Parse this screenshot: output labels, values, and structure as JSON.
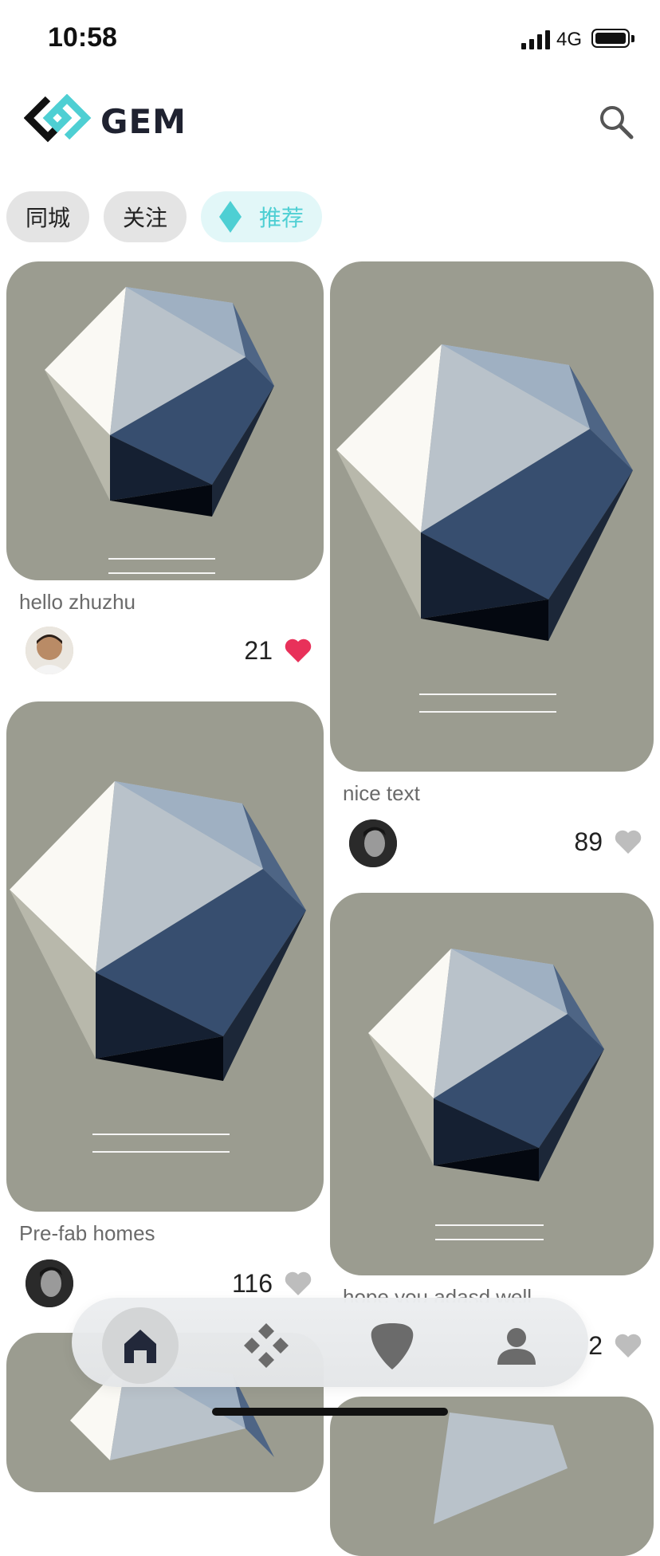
{
  "status_bar": {
    "time": "10:58",
    "network": "4G"
  },
  "header": {
    "logo_text": "GEM",
    "search_icon": "search-icon"
  },
  "tabs": [
    {
      "label": "同城",
      "active": false
    },
    {
      "label": "关注",
      "active": false
    },
    {
      "label": "推荐",
      "active": true,
      "icon": "diamond-icon"
    }
  ],
  "colors": {
    "accent": "#4ecfd3",
    "card_bg": "#9b9c90",
    "like_active": "#e8315a",
    "like_inactive": "#bdbdbd"
  },
  "feed": {
    "left": [
      {
        "title": "hello zhuzhu",
        "likes": "21",
        "liked": true
      },
      {
        "title": "Pre-fab homes",
        "likes": "116",
        "liked": false
      },
      {
        "title": "",
        "likes": "",
        "liked": false
      }
    ],
    "right": [
      {
        "title": "nice text",
        "likes": "89",
        "liked": false
      },
      {
        "title": "hope you adasd well",
        "likes": "2",
        "liked": false
      },
      {
        "title": "",
        "likes": "",
        "liked": false
      }
    ]
  },
  "bottom_nav": [
    {
      "name": "home",
      "icon": "home-icon",
      "active": true
    },
    {
      "name": "discover",
      "icon": "grid-diamond-icon",
      "active": false
    },
    {
      "name": "pick",
      "icon": "guitar-pick-icon",
      "active": false
    },
    {
      "name": "profile",
      "icon": "person-icon",
      "active": false
    }
  ]
}
